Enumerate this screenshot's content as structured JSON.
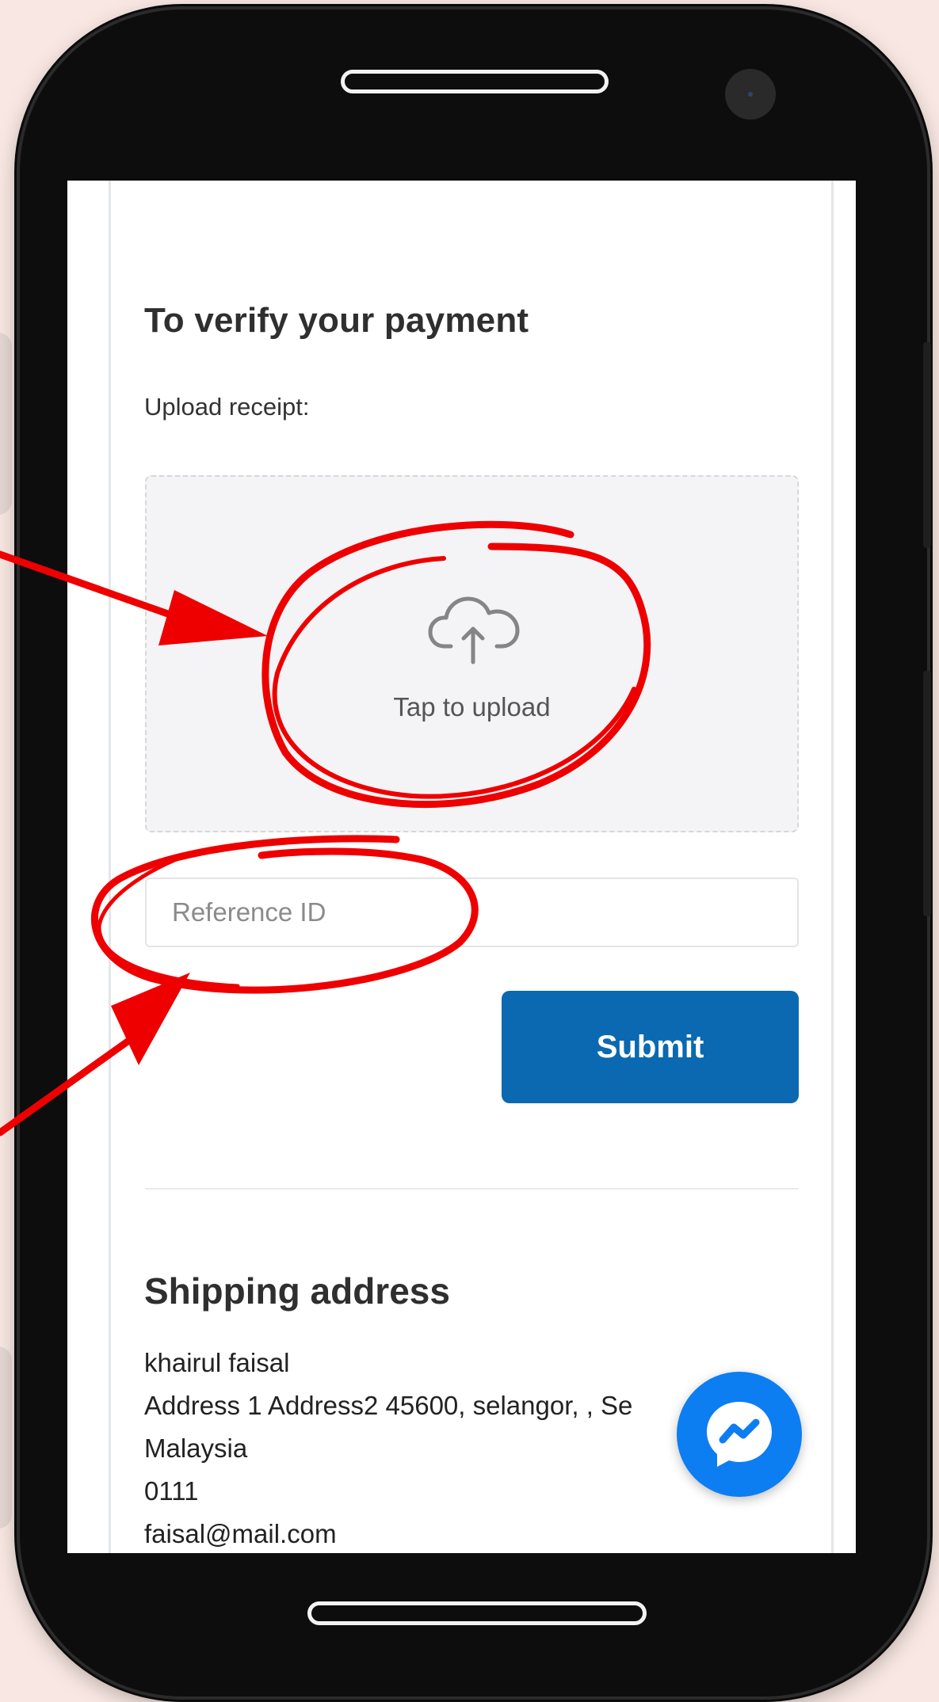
{
  "payment": {
    "title": "To verify your payment",
    "upload_label": "Upload receipt:",
    "upload_prompt": "Tap to upload",
    "reference_placeholder": "Reference ID",
    "reference_value": "",
    "submit_label": "Submit"
  },
  "shipping": {
    "title": "Shipping address",
    "name": "khairul faisal",
    "address_line": "Address 1 Address2 45600, selangor, , Se",
    "country": "Malaysia",
    "phone": "0111",
    "email": "faisal@mail.com"
  },
  "icons": {
    "upload": "cloud-upload-icon",
    "chat": "messenger-icon"
  },
  "colors": {
    "submit_button": "#0a69b0",
    "messenger_button": "#0d7df2",
    "annotation": "#ee0000"
  }
}
